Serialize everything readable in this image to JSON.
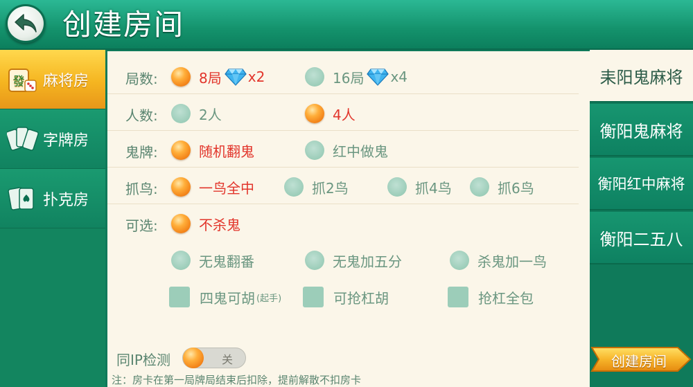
{
  "header": {
    "title": "创建房间",
    "back_icon": "back-arrow-icon"
  },
  "sidebar": {
    "items": [
      {
        "label": "麻将房",
        "icon": "mahjong-tile-icon",
        "active": true
      },
      {
        "label": "字牌房",
        "icon": "zipai-cards-icon",
        "active": false
      },
      {
        "label": "扑克房",
        "icon": "poker-cards-icon",
        "active": false
      }
    ]
  },
  "options": {
    "rounds": {
      "label": "局数:",
      "choices": [
        {
          "text": "8局",
          "cost": "x2",
          "selected": true
        },
        {
          "text": "16局",
          "cost": "x4",
          "selected": false
        }
      ]
    },
    "players": {
      "label": "人数:",
      "choices": [
        {
          "text": "2人",
          "selected": false
        },
        {
          "text": "4人",
          "selected": true
        }
      ]
    },
    "ghost": {
      "label": "鬼牌:",
      "choices": [
        {
          "text": "随机翻鬼",
          "selected": true
        },
        {
          "text": "红中做鬼",
          "selected": false
        }
      ]
    },
    "bird": {
      "label": "抓鸟:",
      "choices": [
        {
          "text": "一鸟全中",
          "selected": true
        },
        {
          "text": "抓2鸟",
          "selected": false
        },
        {
          "text": "抓4鸟",
          "selected": false
        },
        {
          "text": "抓6鸟",
          "selected": false
        }
      ]
    },
    "optional": {
      "label": "可选:",
      "radios": [
        {
          "text": "不杀鬼",
          "selected": true
        },
        {
          "text": "无鬼翻番",
          "selected": false
        },
        {
          "text": "无鬼加五分",
          "selected": false
        },
        {
          "text": "杀鬼加一鸟",
          "selected": false
        }
      ],
      "checks": [
        {
          "text": "四鬼可胡",
          "sub": "(起手)",
          "checked": false
        },
        {
          "text": "可抢杠胡",
          "checked": false
        },
        {
          "text": "抢杠全包",
          "checked": false
        }
      ]
    }
  },
  "ip_check": {
    "label": "同IP检测",
    "state_text": "关",
    "on": false
  },
  "note": "注：房卡在第一局牌局结束后扣除，提前解散不扣房卡",
  "modes": [
    {
      "label": "耒阳鬼麻将",
      "active": true
    },
    {
      "label": "衡阳鬼麻将",
      "active": false
    },
    {
      "label": "衡阳红中麻将",
      "active": false
    },
    {
      "label": "衡阳二五八",
      "active": false
    }
  ],
  "create_button": {
    "label": "创建房间"
  },
  "colors": {
    "header_green": "#14926c",
    "panel_bg": "#fbf6e9",
    "selected_text": "#e2352b",
    "accent_orange": "#f07a12",
    "sidebar_active": "#f5b520"
  }
}
